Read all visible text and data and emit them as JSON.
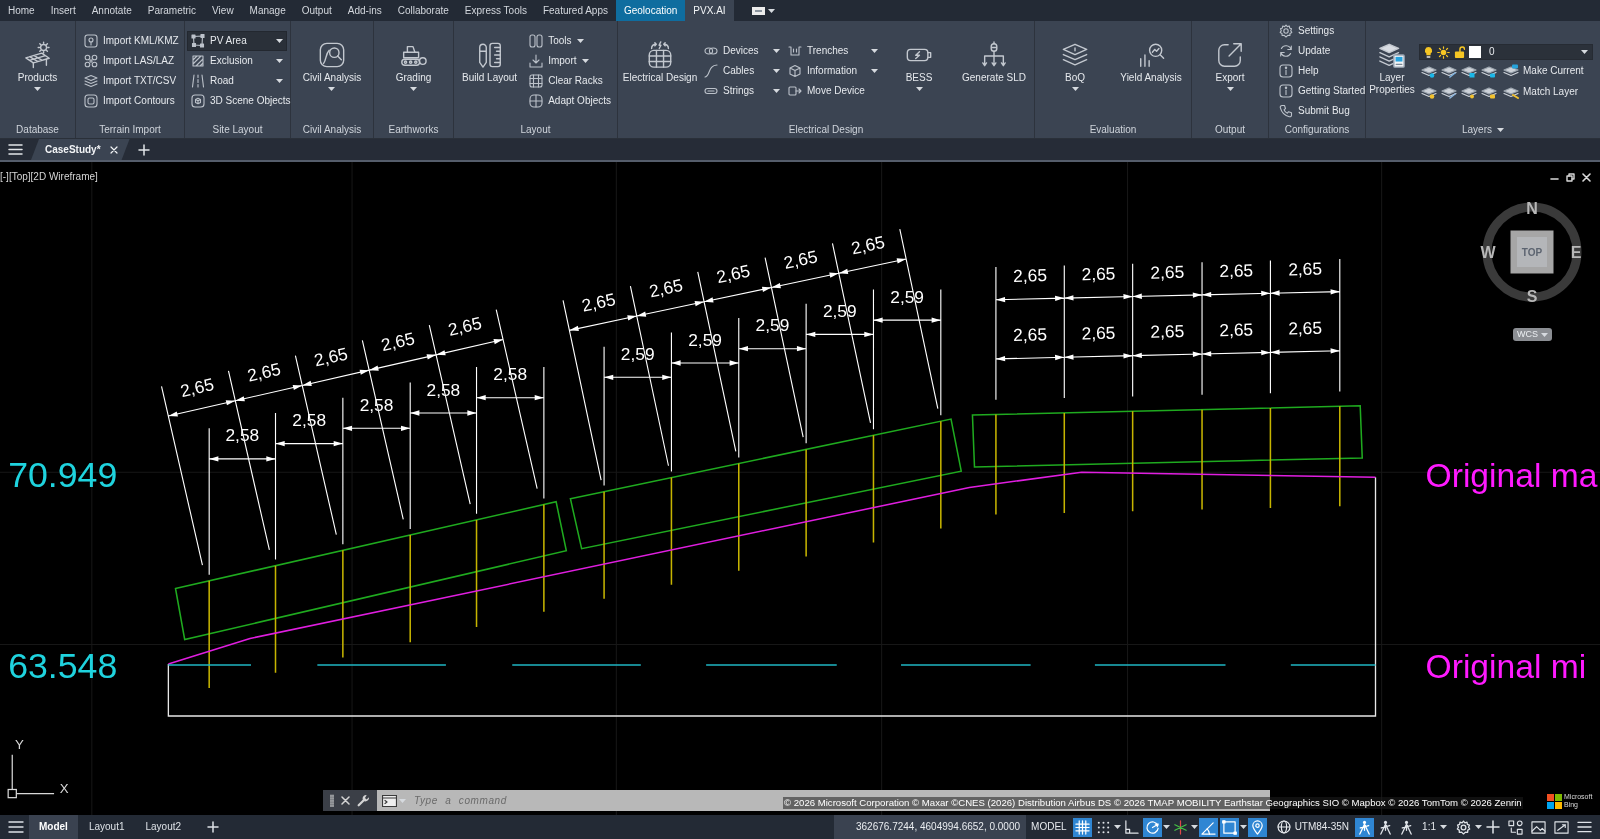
{
  "ribbon_tabs": [
    {
      "label": "Home",
      "selected": false,
      "contextual": false
    },
    {
      "label": "Insert",
      "selected": false,
      "contextual": false
    },
    {
      "label": "Annotate",
      "selected": false,
      "contextual": false
    },
    {
      "label": "Parametric",
      "selected": false,
      "contextual": false
    },
    {
      "label": "View",
      "selected": false,
      "contextual": false
    },
    {
      "label": "Manage",
      "selected": false,
      "contextual": false
    },
    {
      "label": "Output",
      "selected": false,
      "contextual": false
    },
    {
      "label": "Add-ins",
      "selected": false,
      "contextual": false
    },
    {
      "label": "Collaborate",
      "selected": false,
      "contextual": false
    },
    {
      "label": "Express Tools",
      "selected": false,
      "contextual": false
    },
    {
      "label": "Featured Apps",
      "selected": false,
      "contextual": false
    },
    {
      "label": "Geolocation",
      "selected": false,
      "contextual": true
    },
    {
      "label": "PVX.AI",
      "selected": true,
      "contextual": false
    }
  ],
  "ribbon_panels": [
    {
      "title": "Database",
      "dropdown": false,
      "groups": [
        {
          "kind": "large",
          "label": "Products",
          "dropdown": true
        }
      ]
    },
    {
      "title": "Terrain Import",
      "dropdown": false,
      "groups": [
        {
          "kind": "stack",
          "items": [
            {
              "label": "Import KML/KMZ",
              "dropdown": false
            },
            {
              "label": "Import LAS/LAZ",
              "dropdown": false
            },
            {
              "label": "Import TXT/CSV",
              "dropdown": false
            },
            {
              "label": "Import Contours",
              "dropdown": false
            }
          ]
        }
      ]
    },
    {
      "title": "Site Layout",
      "dropdown": false,
      "groups": [
        {
          "kind": "stack",
          "items": [
            {
              "label": "PV Area",
              "dropdown": true,
              "active": true
            },
            {
              "label": "Exclusion",
              "dropdown": true,
              "active": false
            },
            {
              "label": "Road",
              "dropdown": true,
              "active": false
            },
            {
              "label": "3D Scene Objects",
              "dropdown": false,
              "active": false
            }
          ]
        }
      ]
    },
    {
      "title": "Civil Analysis",
      "dropdown": false,
      "groups": [
        {
          "kind": "large",
          "label": "Civil Analysis",
          "dropdown": true
        }
      ]
    },
    {
      "title": "Earthworks",
      "dropdown": false,
      "groups": [
        {
          "kind": "large",
          "label": "Grading",
          "dropdown": true
        }
      ]
    },
    {
      "title": "Layout",
      "dropdown": false,
      "groups": [
        {
          "kind": "large",
          "label": "Build Layout",
          "dropdown": false
        },
        {
          "kind": "stack",
          "items": [
            {
              "label": "Tools",
              "dropdown": true
            },
            {
              "label": "Import",
              "dropdown": true
            },
            {
              "label": "Clear Racks",
              "dropdown": false
            },
            {
              "label": "Adapt Objects",
              "dropdown": false
            }
          ]
        }
      ]
    },
    {
      "title": "Electrical Design",
      "dropdown": false,
      "groups": [
        {
          "kind": "large",
          "label": "Electrical Design",
          "dropdown": false
        },
        {
          "kind": "stack",
          "items": [
            {
              "label": "Devices",
              "dropdown": true
            },
            {
              "label": "Cables",
              "dropdown": true
            },
            {
              "label": "Strings",
              "dropdown": true
            }
          ]
        },
        {
          "kind": "stack",
          "items": [
            {
              "label": "Trenches",
              "dropdown": true
            },
            {
              "label": "Information",
              "dropdown": true
            },
            {
              "label": "Move Device",
              "dropdown": false
            }
          ]
        },
        {
          "kind": "large",
          "label": "BESS",
          "dropdown": true
        },
        {
          "kind": "large",
          "label": "Generate SLD",
          "dropdown": false
        }
      ]
    },
    {
      "title": "Evaluation",
      "dropdown": false,
      "groups": [
        {
          "kind": "large",
          "label": "BoQ",
          "dropdown": true
        },
        {
          "kind": "large",
          "label": "Yield Analysis",
          "dropdown": false
        }
      ]
    },
    {
      "title": "Output",
      "dropdown": false,
      "groups": [
        {
          "kind": "large",
          "label": "Export",
          "dropdown": true
        }
      ]
    },
    {
      "title": "Configurations",
      "dropdown": false,
      "groups": [
        {
          "kind": "stack",
          "items": [
            {
              "label": "Settings",
              "dropdown": false
            },
            {
              "label": "Update",
              "dropdown": false
            },
            {
              "label": "Help",
              "dropdown": false
            },
            {
              "label": "Getting Started",
              "dropdown": false
            },
            {
              "label": "Submit Bug",
              "dropdown": false
            }
          ]
        }
      ]
    },
    {
      "title": "Layers",
      "dropdown": true,
      "groups": [
        {
          "kind": "large",
          "label": "Layer Properties",
          "dropdown": false
        },
        {
          "kind": "layer-controls",
          "current_layer": {
            "name": "0",
            "on": true,
            "frozen": false,
            "locked": false
          },
          "actions": [
            {
              "label": "Make Current"
            },
            {
              "label": "Match Layer"
            }
          ]
        }
      ]
    }
  ],
  "document_tabs": [
    {
      "label": "CaseStudy*",
      "selected": true
    }
  ],
  "viewport": {
    "controls": [
      "[-]",
      "[Top]",
      "[2D Wireframe]"
    ],
    "viewcube": {
      "north": "N",
      "east": "E",
      "south": "S",
      "west": "W",
      "face": "TOP",
      "coordinate_system": "WCS"
    },
    "drawing": {
      "pv_tables": [
        {
          "upper_dimensions": [
            "2,65",
            "2,65",
            "2,65",
            "2,65",
            "2,65"
          ],
          "lower_dimensions": [
            "2,58",
            "2,58",
            "2,58",
            "2,58",
            "2,58"
          ]
        },
        {
          "upper_dimensions": [
            "2,65",
            "2,65",
            "2,65",
            "2,65",
            "2,65"
          ],
          "lower_dimensions": [
            "2,59",
            "2,59",
            "2,59",
            "2,59",
            "2,59"
          ]
        },
        {
          "upper_dimensions": [
            "2,65",
            "2,65",
            "2,65",
            "2,65",
            "2,65"
          ],
          "lower_dimensions": [
            "2,65",
            "2,65",
            "2,65",
            "2,65",
            "2,65"
          ]
        }
      ],
      "elevation_labels": [
        "70.949",
        "63.548"
      ],
      "profile_labels": [
        "Original ma",
        "Original mi"
      ]
    },
    "ucs_axes": {
      "x": "X",
      "y": "Y"
    }
  },
  "command_line": {
    "placeholder": "Type a command"
  },
  "map_attribution": "© 2026 Microsoft Corporation © Maxar ©CNES (2026) Distribution Airbus DS © 2026 TMAP MOBILITY Earthstar Geographics SIO © Mapbox © 2026 TomTom © 2026 Zenrin",
  "map_provider_logo": [
    "Microsoft",
    "Bing"
  ],
  "status_bar": {
    "layout_tabs": [
      {
        "label": "Model",
        "selected": true
      },
      {
        "label": "Layout1",
        "selected": false
      },
      {
        "label": "Layout2",
        "selected": false
      }
    ],
    "coordinates": "362676.7244, 4604994.6652, 0.0000",
    "space": "MODEL",
    "drafting_toggles": [
      {
        "kind": "grid",
        "on": true,
        "dropdown": false
      },
      {
        "kind": "snap",
        "on": false,
        "dropdown": true
      },
      {
        "kind": "ortho",
        "on": false,
        "dropdown": false
      },
      {
        "kind": "polar",
        "on": true,
        "dropdown": true
      },
      {
        "kind": "isometric",
        "on": false,
        "dropdown": true
      },
      {
        "kind": "tracking",
        "on": true,
        "dropdown": false
      },
      {
        "kind": "osnap",
        "on": true,
        "dropdown": true
      },
      {
        "kind": "geolocation",
        "on": true,
        "dropdown": false
      }
    ],
    "coordinate_system": "UTM84-35N",
    "annotation_toggles": [
      {
        "on": true
      },
      {
        "on": false
      },
      {
        "on": false
      }
    ],
    "annotation_scale": "1:1"
  }
}
